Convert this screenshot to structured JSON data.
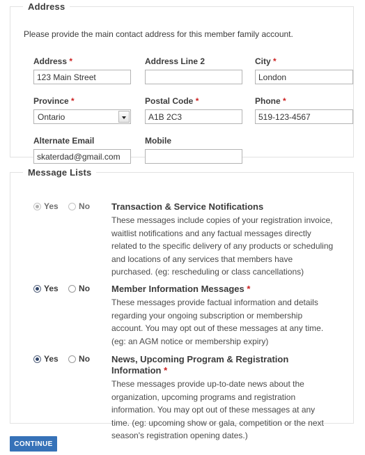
{
  "address_section": {
    "legend": "Address",
    "intro": "Please provide the main contact address for this member family account.",
    "fields": [
      {
        "label": "Address",
        "required": "*",
        "value": "123 Main Street",
        "placeholder": ""
      },
      {
        "label": "Address Line 2",
        "required": "",
        "value": "",
        "placeholder": ""
      },
      {
        "label": "City",
        "required": "*",
        "value": "London",
        "placeholder": ""
      },
      {
        "label": "Province",
        "required": "*",
        "value": "Ontario",
        "placeholder": ""
      },
      {
        "label": "Postal Code",
        "required": "*",
        "value": "A1B 2C3",
        "placeholder": ""
      },
      {
        "label": "Phone",
        "required": "*",
        "value": "519-123-4567",
        "placeholder": ""
      },
      {
        "label": "Alternate Email",
        "required": "",
        "value": "skaterdad@gmail.com",
        "placeholder": ""
      },
      {
        "label": "Mobile",
        "required": "",
        "value": "",
        "placeholder": ""
      }
    ]
  },
  "message_section": {
    "legend": "Message Lists",
    "yes_label": "Yes",
    "no_label": "No",
    "items": [
      {
        "title": "Transaction & Service Notifications",
        "required": "",
        "description": "These messages include copies of your registration invoice, waitlist notifications and any factual messages directly related to the specific delivery of any products or scheduling and locations of any services that members have purchased. (eg: rescheduling or class cancellations)",
        "selected": "Yes"
      },
      {
        "title": "Member Information Messages",
        "required": "*",
        "description": "These messages provide factual information and details regarding your ongoing subscription or membership account. You may opt out of these messages at any time. (eg: an AGM notice or membership expiry)",
        "selected": "Yes"
      },
      {
        "title": "News, Upcoming Program & Registration Information",
        "required": "*",
        "description": "These messages provide up-to-date news about the organization, upcoming programs and registration information. You may opt out of these messages at any time. (eg: upcoming show or gala, competition or the next season's registration opening dates.)",
        "selected": "Yes"
      }
    ]
  },
  "footer": {
    "continue_label": "CONTINUE"
  },
  "colors": {
    "accent": "#3672b8",
    "required": "#cc2222",
    "radio_fill": "#33476b",
    "border": "#e2e2e2"
  }
}
